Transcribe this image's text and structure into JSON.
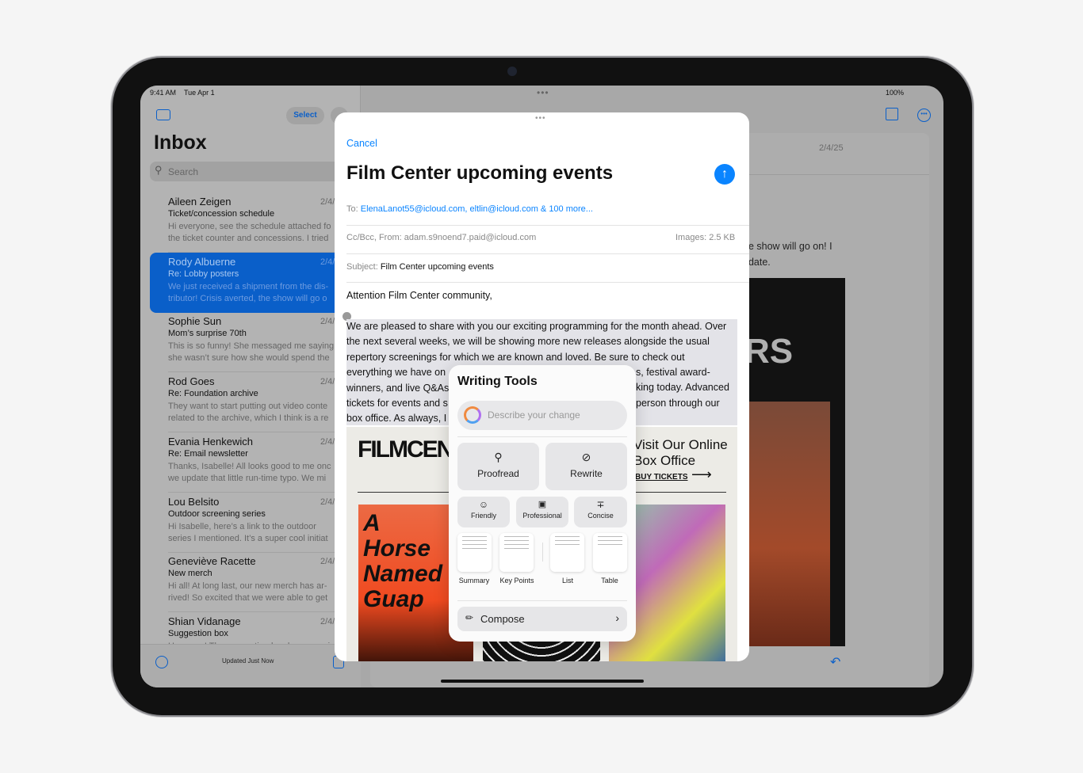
{
  "status": {
    "time": "9:41 AM",
    "date": "Tue Apr 1",
    "battery": "100%"
  },
  "sidebar": {
    "select_label": "Select",
    "title": "Inbox",
    "search_placeholder": "Search",
    "updated": "Updated Just Now",
    "emails": [
      {
        "name": "Aileen Zeigen",
        "date": "2/4/",
        "subject": "Ticket/concession schedule",
        "preview": [
          "Hi everyone, see the schedule attached fo",
          "the ticket counter and concessions. I tried"
        ]
      },
      {
        "name": "Rody Albuerne",
        "date": "2/4/",
        "subject": "Re: Lobby posters",
        "preview": [
          "We just received a shipment from the dis-",
          "tributor! Crisis averted, the show will go o"
        ],
        "selected": true
      },
      {
        "name": "Sophie Sun",
        "date": "2/4/",
        "subject": "Mom’s surprise 70th",
        "preview": [
          "This is so funny! She messaged me saying",
          "she wasn’t sure how she would spend the"
        ]
      },
      {
        "name": "Rod Goes",
        "date": "2/4/",
        "subject": "Re: Foundation archive",
        "preview": [
          "They want to start putting out video conte",
          "related to the archive, which I think is a re"
        ]
      },
      {
        "name": "Evania Henkewich",
        "date": "2/4/",
        "subject": "Re: Email newsletter",
        "preview": [
          "Thanks, Isabelle! All looks good to me onc",
          "we update that little run-time typo. We mi"
        ]
      },
      {
        "name": "Lou Belsito",
        "date": "2/4/",
        "subject": "Outdoor screening series",
        "preview": [
          "Hi Isabelle, here’s a link to the outdoor",
          "series I mentioned. It’s a super cool initiat"
        ]
      },
      {
        "name": "Geneviève Racette",
        "date": "2/4/",
        "subject": "New merch",
        "preview": [
          "Hi all! At long last, our new merch has ar-",
          "rived! So excited that we were able to get"
        ]
      },
      {
        "name": "Shian Vidanage",
        "date": "2/4/",
        "subject": "Suggestion box",
        "preview": [
          "Hey guys! The suggestion box has some i",
          ""
        ]
      }
    ]
  },
  "reader": {
    "date": "2/4/25",
    "body_fragments": [
      "he show will go on! I",
      "pdate."
    ],
    "poster_text": "RS"
  },
  "compose": {
    "cancel": "Cancel",
    "title": "Film Center upcoming events",
    "to_label": "To:",
    "to_value": "ElenaLanot55@icloud.com, eltlin@icloud.com & 100 more...",
    "ccfrom_label": "Cc/Bcc, From:",
    "from_value": "adam.s9noend7.paid@icloud.com",
    "images_label": "Images:",
    "images_value": "2.5 KB",
    "subject_label": "Subject:",
    "subject_value": "Film Center upcoming events",
    "greeting": "Attention Film Center community,",
    "body_lines": [
      "We are pleased to share with you our exciting programming for the month ahead. Over",
      "the next several weeks, we will be showing more new releases alongside the usual",
      "repertory screenings for which we are known and loved. Be sure to check out"
    ],
    "body_left": [
      "everything we have on",
      "winners, and live Q&As",
      "tickets for events and s",
      "box office. As always, I"
    ],
    "body_right": [
      "s, festival award-",
      "king today. Advanced",
      "person through our"
    ],
    "newsletter": {
      "logo": "FILMCENT",
      "visit": "Visit Our Online Box Office",
      "buy": "BUY TICKETS",
      "poster1": "A Horse Named Guap"
    }
  },
  "writing_tools": {
    "title": "Writing Tools",
    "placeholder": "Describe your change",
    "proofread": "Proofread",
    "rewrite": "Rewrite",
    "friendly": "Friendly",
    "professional": "Professional",
    "concise": "Concise",
    "summary": "Summary",
    "key_points": "Key Points",
    "list": "List",
    "table": "Table",
    "compose": "Compose"
  },
  "colors": {
    "accent": "#0a84ff",
    "selection": "#0a5fc9"
  }
}
